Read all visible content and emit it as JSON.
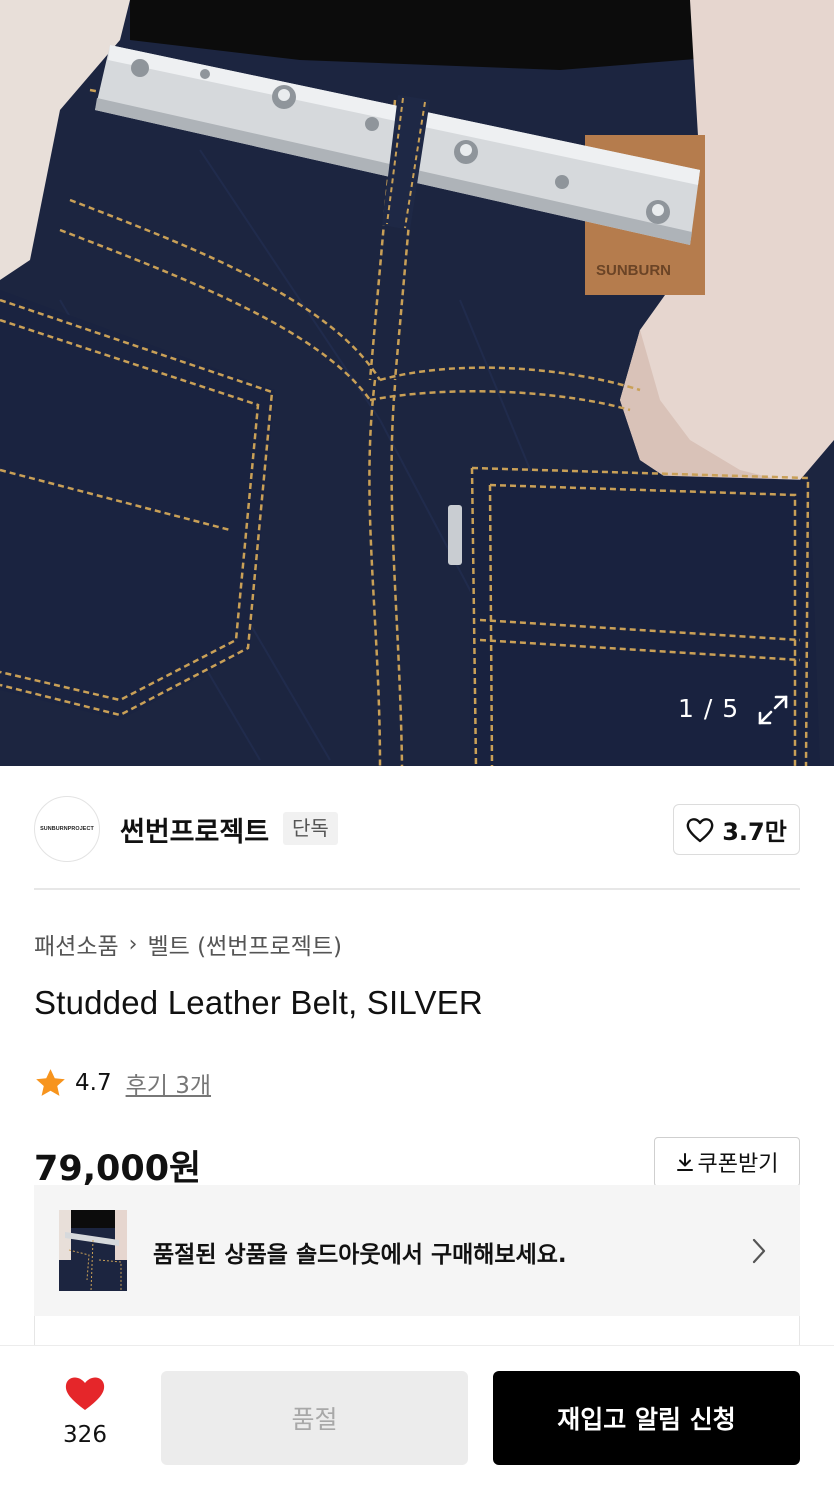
{
  "gallery": {
    "counter": "1 / 5",
    "label_text": "SUNBURN"
  },
  "brand": {
    "logo_text": "SUNBURNPROJECT",
    "name": "썬번프로젝트",
    "badge": "단독",
    "likes": "3.7만"
  },
  "product": {
    "breadcrumb": [
      "패션소품",
      "벨트 (썬번프로젝트)"
    ],
    "title": "Studded Leather Belt, SILVER",
    "rating": "4.7",
    "review_link": "후기 3개",
    "price": "79,000원",
    "coupon_label": "쿠폰받기"
  },
  "soldout_banner": {
    "text": "품절된 상품을 솔드아웃에서 구매해보세요."
  },
  "bottom_bar": {
    "wish_count": "326",
    "soldout_label": "품절",
    "restock_label": "재입고 알림 신청"
  },
  "colors": {
    "denim": "#1c2540",
    "stitch": "#c9a057",
    "heart": "#e5262a",
    "star": "#f7941d",
    "primary_button": "#000000",
    "disabled_button": "#ececec"
  },
  "icons": [
    "expand-icon",
    "heart-outline-icon",
    "star-icon",
    "download-icon",
    "chevron-right-icon",
    "heart-filled-icon"
  ]
}
